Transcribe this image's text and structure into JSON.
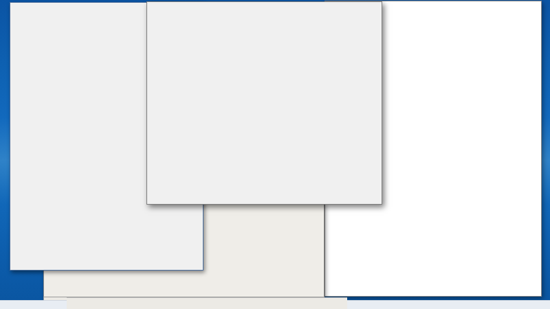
{
  "PLACEHOLDER": true
}
